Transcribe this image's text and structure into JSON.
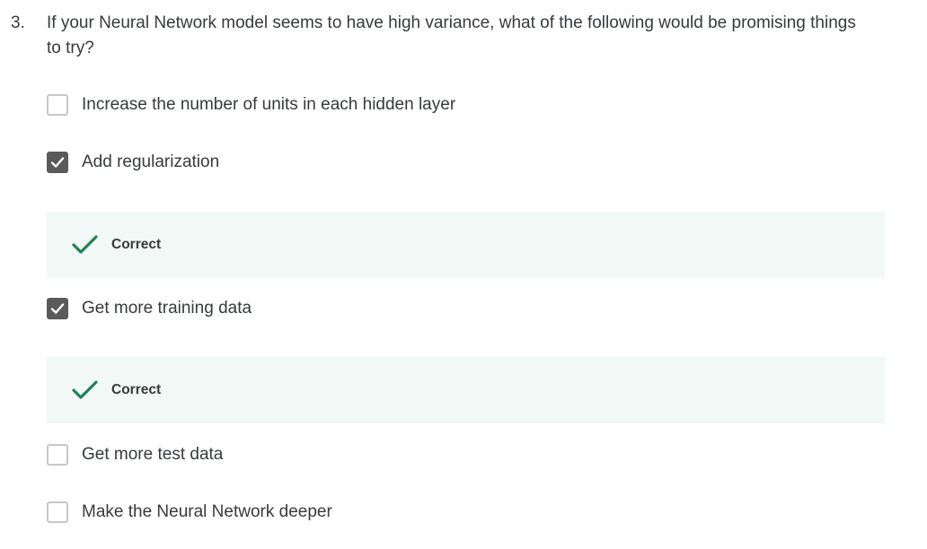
{
  "question": {
    "number": "3.",
    "text": "If your Neural Network model seems to have high variance, what of the following would be promising things to try?"
  },
  "options": [
    {
      "label": "Increase the number of units in each hidden layer",
      "checked": false
    },
    {
      "label": "Add regularization",
      "checked": true,
      "feedback": "Correct"
    },
    {
      "label": "Get more training data",
      "checked": true,
      "feedback": "Correct"
    },
    {
      "label": "Get more test data",
      "checked": false
    },
    {
      "label": "Make the Neural Network deeper",
      "checked": false
    }
  ],
  "colors": {
    "checked_box": "#5a5a5a",
    "correct_check": "#1f8354",
    "feedback_bg": "#f2f8f5",
    "text": "#373a3c"
  },
  "icons": {
    "checkbox_checked": "checkmark-icon",
    "feedback": "correct-check-icon"
  }
}
